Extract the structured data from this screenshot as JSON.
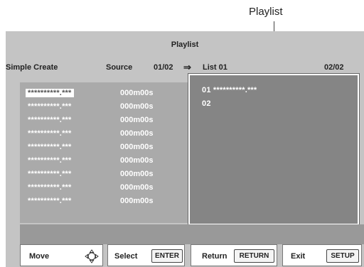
{
  "callout": {
    "label": "Playlist"
  },
  "header": {
    "title": "Playlist",
    "mode": "Simple Create",
    "source_label": "Source",
    "source_page": "01/02",
    "arrow": "⇒",
    "list_label": "List 01",
    "list_page": "02/02"
  },
  "source_list": [
    {
      "name": "**********.***",
      "duration": "000m00s",
      "selected": true
    },
    {
      "name": "**********.***",
      "duration": "000m00s"
    },
    {
      "name": "**********.***",
      "duration": "000m00s"
    },
    {
      "name": "**********.***",
      "duration": "000m00s"
    },
    {
      "name": "**********.***",
      "duration": "000m00s"
    },
    {
      "name": "**********.***",
      "duration": "000m00s"
    },
    {
      "name": "**********.***",
      "duration": "000m00s"
    },
    {
      "name": "**********.***",
      "duration": "000m00s"
    },
    {
      "name": "**********.***",
      "duration": "000m00s"
    }
  ],
  "playlist": [
    {
      "text": "01 **********.***"
    },
    {
      "text": "02"
    }
  ],
  "buttons": {
    "move": {
      "label": "Move",
      "icon": "move-cross-icon"
    },
    "select": {
      "label": "Select",
      "key": "ENTER"
    },
    "return": {
      "label": "Return",
      "key": "RETURN"
    },
    "exit": {
      "label": "Exit",
      "key": "SETUP"
    }
  }
}
